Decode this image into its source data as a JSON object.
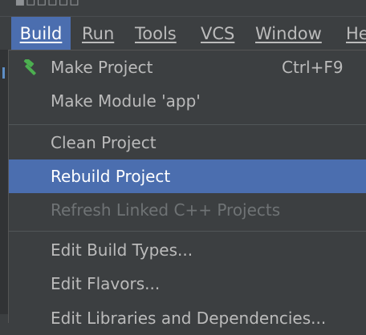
{
  "menubar": {
    "items": [
      {
        "label": "Build"
      },
      {
        "label": "Run"
      },
      {
        "label": "Tools"
      },
      {
        "label": "VCS"
      },
      {
        "label": "Window"
      },
      {
        "label": "He"
      }
    ]
  },
  "build_menu": {
    "items": [
      {
        "label": "Make Project",
        "shortcut": "Ctrl+F9",
        "icon": "hammer-icon"
      },
      {
        "label": "Make Module 'app'"
      },
      {
        "label": "Clean Project"
      },
      {
        "label": "Rebuild Project",
        "state": "highlighted"
      },
      {
        "label": "Refresh Linked C++ Projects",
        "state": "disabled"
      },
      {
        "label": "Edit Build Types..."
      },
      {
        "label": "Edit Flavors..."
      },
      {
        "label": "Edit Libraries and Dependencies..."
      }
    ]
  },
  "colors": {
    "background": "#3c3f41",
    "highlight": "#4b6eaf",
    "text": "#bbbbbb",
    "disabled_text": "#6f7375",
    "hammer": "#4caf50"
  }
}
